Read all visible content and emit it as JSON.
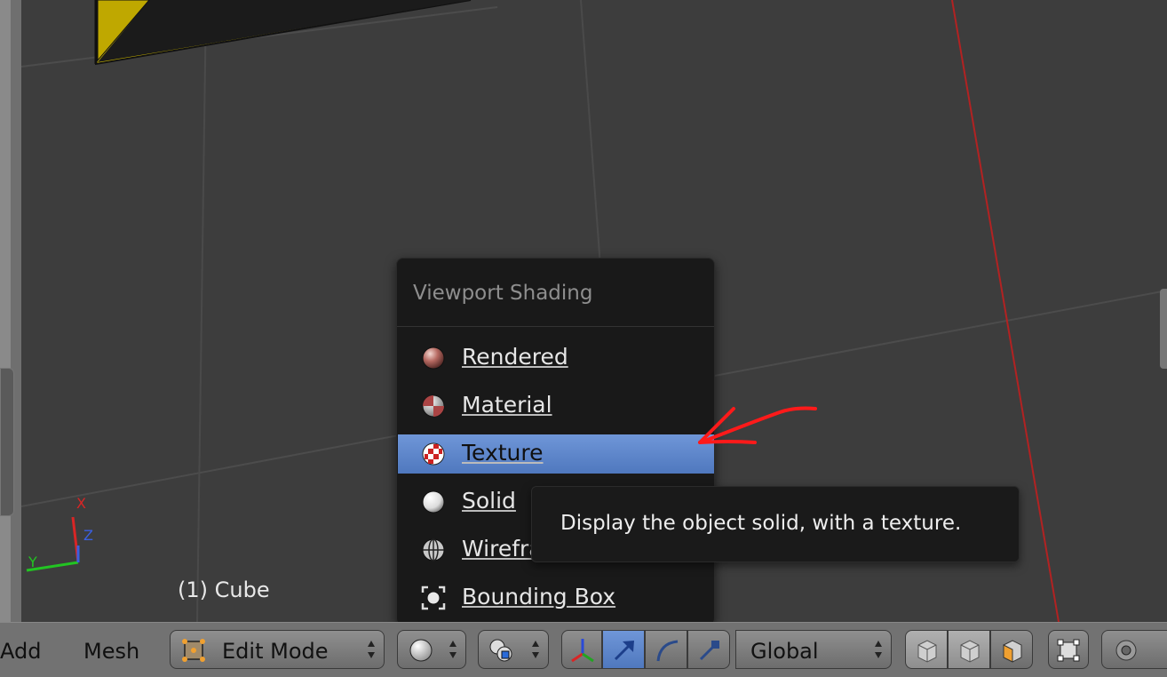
{
  "viewport": {
    "object_label": "(1) Cube",
    "axes": {
      "x": "X",
      "y": "Y",
      "z": "Z"
    }
  },
  "shading_menu": {
    "title": "Viewport Shading",
    "items": [
      {
        "label": "Rendered",
        "icon": "rendered-sphere-icon",
        "active": false
      },
      {
        "label": "Material",
        "icon": "material-sphere-icon",
        "active": false
      },
      {
        "label": "Texture",
        "icon": "texture-sphere-icon",
        "active": true
      },
      {
        "label": "Solid",
        "icon": "solid-sphere-icon",
        "active": false
      },
      {
        "label": "Wireframe",
        "icon": "wireframe-sphere-icon",
        "active": false
      },
      {
        "label": "Bounding Box",
        "icon": "bounding-box-icon",
        "active": false
      }
    ]
  },
  "tooltip": {
    "text": "Display the object solid, with a texture."
  },
  "header": {
    "add_label": "Add",
    "mesh_label": "Mesh",
    "mode_label": "Edit Mode",
    "orientation_label": "Global"
  },
  "colors": {
    "accent_blue": "#5a84c8",
    "annotation_red": "#ff1a1a",
    "menu_bg": "#191919",
    "header_bg": "#727272",
    "viewport_bg": "#3d3d3d"
  }
}
